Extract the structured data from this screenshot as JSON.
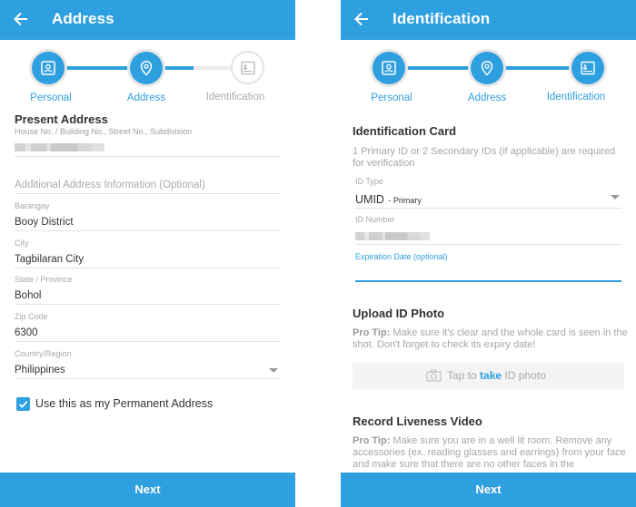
{
  "colors": {
    "primary": "#2e9fdf",
    "inactive": "#e4e4e4",
    "text": "#333333",
    "muted": "#a8a8a8"
  },
  "left": {
    "appbar": {
      "title": "Address",
      "back_icon": "arrow-left-icon"
    },
    "steps": [
      {
        "label": "Personal",
        "icon": "id-badge-icon",
        "state": "done"
      },
      {
        "label": "Address",
        "icon": "location-pin-icon",
        "state": "active"
      },
      {
        "label": "Identification",
        "icon": "id-card-icon",
        "state": "inactive"
      }
    ],
    "progress_between_step2_step3": 0.45,
    "section_title": "Present Address",
    "house_hint": "House No. / Building No., Street No., Subdivision",
    "house_value": "[redacted]",
    "additional_placeholder": "Additional Address Information (Optional)",
    "fields": [
      {
        "label": "Barangay",
        "value": "Booy District"
      },
      {
        "label": "City",
        "value": "Tagbilaran City"
      },
      {
        "label": "State / Province",
        "value": "Bohol"
      },
      {
        "label": "Zip Code",
        "value": "6300"
      },
      {
        "label": "Country/Region",
        "value": "Philippines"
      }
    ],
    "checkbox": {
      "label": "Use this as my Permanent Address",
      "checked": true
    },
    "next_label": "Next"
  },
  "right": {
    "appbar": {
      "title": "Identification",
      "back_icon": "arrow-left-icon"
    },
    "steps": [
      {
        "label": "Personal",
        "icon": "id-badge-icon",
        "state": "done"
      },
      {
        "label": "Address",
        "icon": "location-pin-icon",
        "state": "done"
      },
      {
        "label": "Identification",
        "icon": "id-card-icon",
        "state": "active"
      }
    ],
    "id_card": {
      "title": "Identification Card",
      "description": "1 Primary ID or 2 Secondary IDs (if applicable) are required for verification",
      "id_type_label": "ID Type",
      "id_type_value": "UMID",
      "id_type_suffix": "- Primary",
      "id_number_label": "ID Number",
      "id_number_value": "[redacted]",
      "expiration_label": "Expiration Date (optional)",
      "expiration_value": ""
    },
    "upload": {
      "title": "Upload ID Photo",
      "tip_prefix": "Pro Tip:",
      "tip_text": " Make sure it's clear and the whole card is seen in the shot. Don't forget to check its expiry date!",
      "button_pre": "Tap to ",
      "button_emph": "take",
      "button_post": " ID photo",
      "button_icon": "camera-icon"
    },
    "liveness": {
      "title": "Record Liveness Video",
      "tip_prefix": "Pro Tip:",
      "tip_text": " Make sure you are in a well lit room. Remove any accessories (ex. reading glasses and earrings) from your face and make sure that there are no other faces in the"
    },
    "next_label": "Next"
  }
}
